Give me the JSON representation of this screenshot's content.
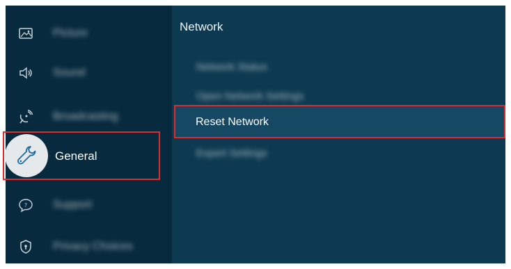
{
  "sidebar": {
    "items": [
      {
        "label": "Picture",
        "icon": "picture-icon"
      },
      {
        "label": "Sound",
        "icon": "sound-icon"
      },
      {
        "label": "Broadcasting",
        "icon": "broadcasting-icon"
      },
      {
        "label": "General",
        "icon": "wrench-icon",
        "selected": true
      },
      {
        "label": "Support",
        "icon": "support-icon"
      },
      {
        "label": "Privacy Choices",
        "icon": "shield-icon"
      }
    ]
  },
  "content": {
    "title": "Network",
    "items": [
      {
        "label": "Network Status"
      },
      {
        "label": "Open Network Settings"
      },
      {
        "label": "Reset Network",
        "selected": true
      },
      {
        "label": "Expert Settings"
      }
    ]
  },
  "colors": {
    "focus_outline": "#e12b2b",
    "sidebar_bg": "#082a3e",
    "content_bg": "#0e3a51"
  }
}
